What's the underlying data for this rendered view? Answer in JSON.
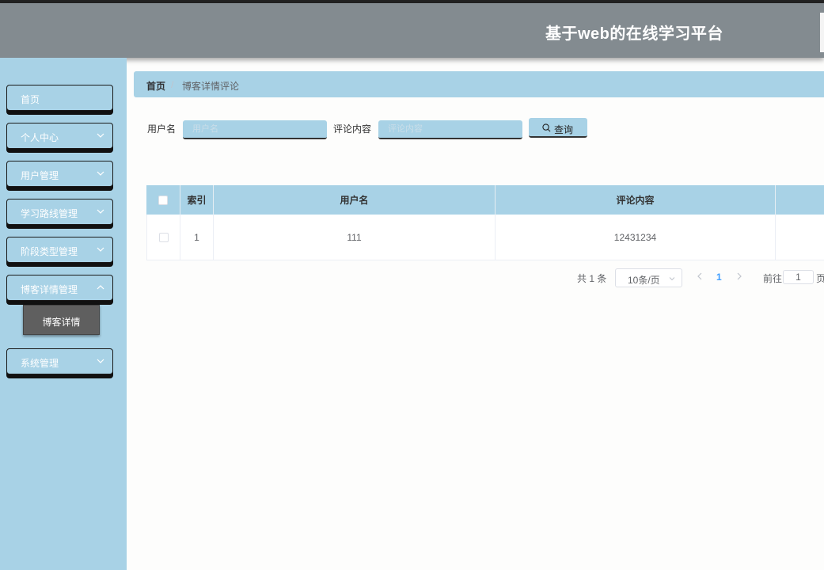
{
  "app": {
    "title": "基于web的在线学习平台"
  },
  "sidebar": {
    "items": [
      {
        "label": "首页",
        "has_arrow": false
      },
      {
        "label": "个人中心",
        "has_arrow": true
      },
      {
        "label": "用户管理",
        "has_arrow": true
      },
      {
        "label": "学习路线管理",
        "has_arrow": true
      },
      {
        "label": "阶段类型管理",
        "has_arrow": true
      },
      {
        "label": "博客详情管理",
        "has_arrow": true,
        "sub_items": [
          {
            "label": "博客详情"
          }
        ]
      },
      {
        "label": "系统管理",
        "has_arrow": true
      }
    ]
  },
  "breadcrumb": {
    "home": "首页",
    "separator": "/",
    "current": "博客详情评论"
  },
  "search": {
    "username_label": "用户名",
    "username_placeholder": "用户名",
    "comment_label": "评论内容",
    "comment_placeholder": "评论内容",
    "query_button": "查询"
  },
  "table": {
    "columns": [
      "索引",
      "用户名",
      "评论内容"
    ],
    "rows": [
      {
        "index": "1",
        "username": "111",
        "comment": "12431234"
      }
    ]
  },
  "pagination": {
    "total_text": "共 1 条",
    "page_size": "10条/页",
    "current_page": "1",
    "goto_label": "前往",
    "goto_value": "1",
    "page_suffix": "页"
  },
  "colors": {
    "header": "#838b90",
    "accent": "#a8d2e6",
    "submenu": "#5f5f5f",
    "active_page": "#409eff"
  }
}
